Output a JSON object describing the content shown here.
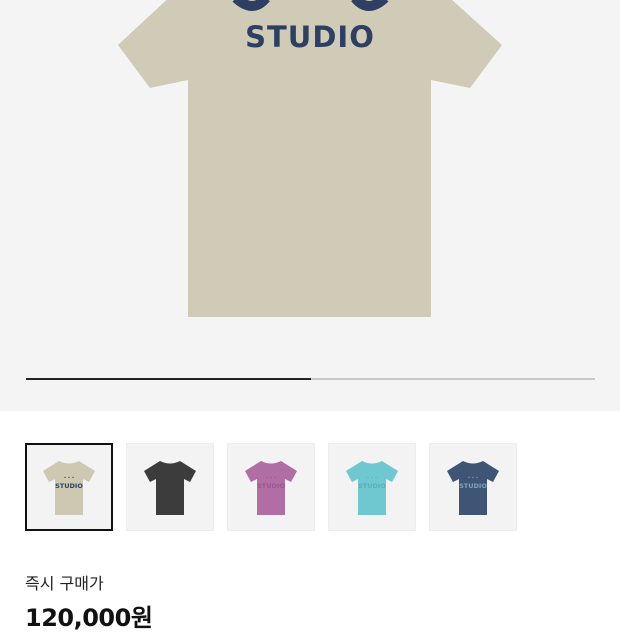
{
  "product": {
    "brand_text": "STUDIO",
    "main_color": "#cfcbb6",
    "print_color": "#2d3f63"
  },
  "gallery": {
    "progress_fraction": 0.5
  },
  "thumbnails": [
    {
      "name": "thumb-beige",
      "shirt": "#cdc8b2",
      "print": "#2d3f63",
      "text": "STUDIO",
      "active": true
    },
    {
      "name": "thumb-charcoal",
      "shirt": "#3c3c3c",
      "print": "#3c3c3c",
      "text": "",
      "active": false
    },
    {
      "name": "thumb-purple",
      "shirt": "#b06ea5",
      "print": "#a0558f",
      "text": "STUDIO",
      "active": false
    },
    {
      "name": "thumb-aqua",
      "shirt": "#6fc7d0",
      "print": "#5bb0ba",
      "text": "STUDIO",
      "active": false
    },
    {
      "name": "thumb-navy",
      "shirt": "#3f5576",
      "print": "#7ea0c4",
      "text": "STUDIO",
      "active": false
    }
  ],
  "purchase": {
    "label": "즉시 구매가",
    "price": "120,000원"
  }
}
